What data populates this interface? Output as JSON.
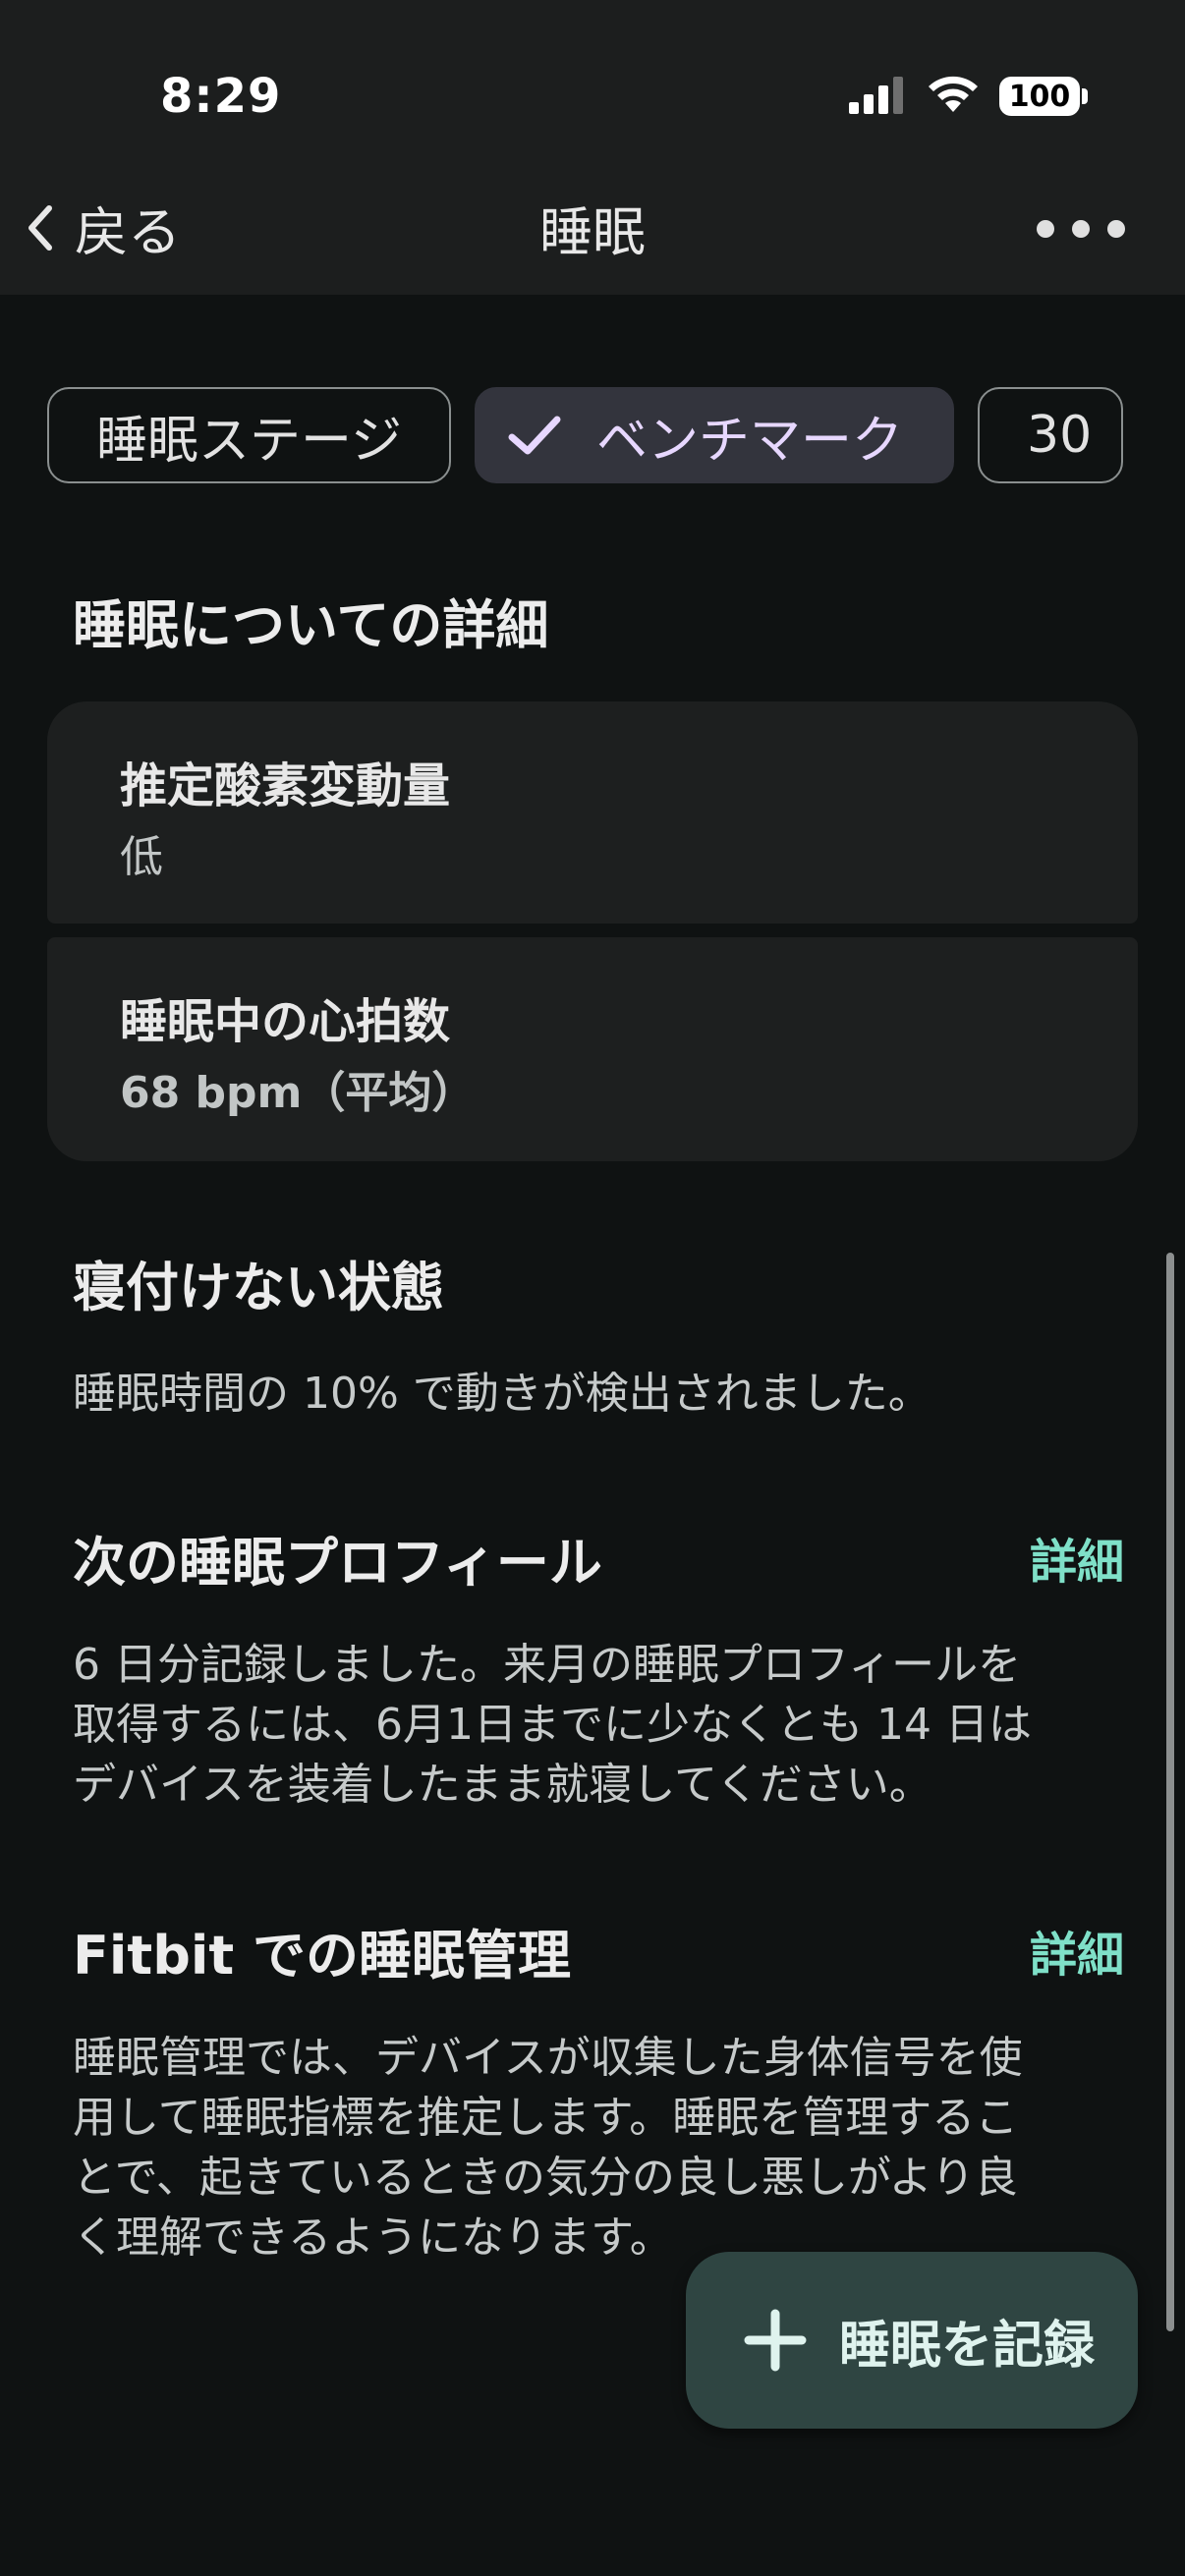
{
  "status_bar": {
    "time": "8:29",
    "battery": "100"
  },
  "nav": {
    "back_label": "戻る",
    "title": "睡眠"
  },
  "chips": [
    {
      "label": "睡眠ステージ",
      "selected": false
    },
    {
      "label": "ベンチマーク",
      "selected": true
    },
    {
      "label": "30",
      "selected": false
    }
  ],
  "details": {
    "title": "睡眠についての詳細",
    "oxygen_label": "推定酸素変動量",
    "oxygen_value": "低",
    "heart_label": "睡眠中の心拍数",
    "heart_value": "68 bpm（平均）"
  },
  "restless": {
    "title": "寝付けない状態",
    "text": "睡眠時間の 10% で動きが検出されました。"
  },
  "profile": {
    "title": "次の睡眠プロフィール",
    "link": "詳細",
    "line1": "6 日分記録しました。来月の睡眠プロフィールを",
    "line2": "取得するには、6月1日までに少なくとも 14 日は",
    "line3": "デバイスを装着したまま就寝してください。"
  },
  "management": {
    "title": "Fitbit での睡眠管理",
    "link": "詳細",
    "line1": "睡眠管理では、デバイスが収集した身体信号を使",
    "line2": "用して睡眠指標を推定します。睡眠を管理するこ",
    "line3": "とで、起きているときの気分の良し悪しがより良",
    "line4": "く理解できるようになります。"
  },
  "fab": {
    "label": "睡眠を記録"
  },
  "colors": {
    "accent_link": "#7fe0c8",
    "selected_chip_text": "#e7d7ff",
    "fab_bg": "#2f4542"
  }
}
